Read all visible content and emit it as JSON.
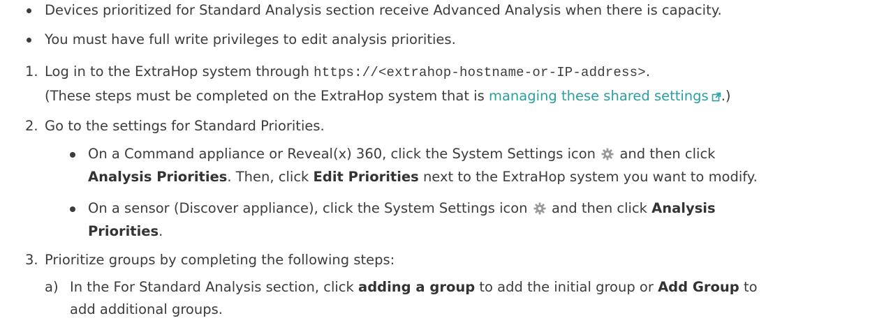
{
  "bullets": [
    "Devices prioritized for Standard Analysis section receive Advanced Analysis when there is capacity.",
    "You must have full write privileges to edit analysis priorities."
  ],
  "steps": {
    "s1": {
      "num": "1.",
      "pre": "Log in to the ExtraHop system through ",
      "code": "https://<extrahop-hostname-or-IP-address>",
      "post": ".",
      "line2_pre": "(These steps must be completed on the ExtraHop system that is ",
      "link": "managing these shared settings",
      "line2_post": ".)"
    },
    "s2": {
      "num": "2.",
      "text": "Go to the settings for Standard Priorities.",
      "sub1": {
        "a": "On a Command appliance or Reveal(x) 360, click the System Settings icon",
        "b": "and then click",
        "c": "Analysis Priorities",
        "d": ". Then, click ",
        "e": "Edit Priorities",
        "f": " next to the ExtraHop system you want to modify."
      },
      "sub2": {
        "a": "On a sensor (Discover appliance), click the System Settings icon",
        "b": "and then click ",
        "c": "Analysis",
        "d": "Priorities",
        "e": "."
      }
    },
    "s3": {
      "num": "3.",
      "text": "Prioritize groups by completing the following steps:",
      "a": {
        "label": "a)",
        "pre": "In the For Standard Analysis section, click ",
        "b1": "adding a group",
        "mid": " to add the initial group or ",
        "b2": "Add Group",
        "post": " to",
        "line2": "add additional groups."
      }
    }
  },
  "icons": {
    "gear": "gear-icon",
    "external": "external-link-icon"
  },
  "colors": {
    "text": "#3c3c3c",
    "link": "#2a9fa0"
  }
}
